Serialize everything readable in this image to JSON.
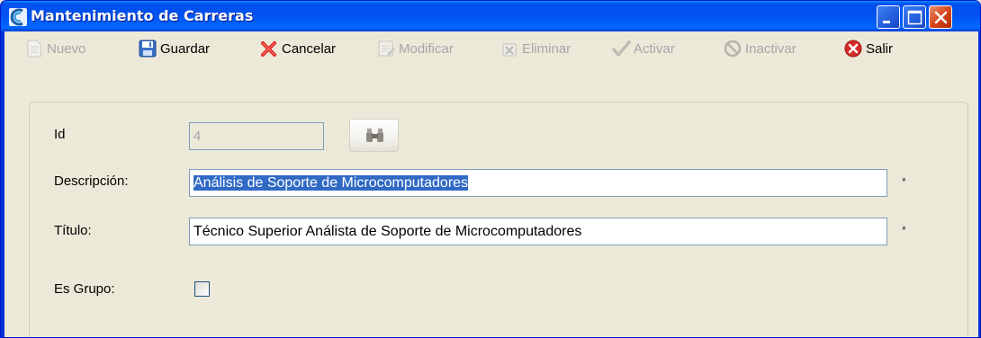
{
  "window": {
    "title": "Mantenimiento de Carreras"
  },
  "toolbar": {
    "nuevo": "Nuevo",
    "guardar": "Guardar",
    "cancelar": "Cancelar",
    "modificar": "Modificar",
    "eliminar": "Eliminar",
    "activar": "Activar",
    "inactivar": "Inactivar",
    "salir": "Salir"
  },
  "form": {
    "id_label": "Id",
    "id_value": "4",
    "descripcion_label": "Descripción:",
    "descripcion_value": "Análisis de Soporte de Microcomputadores",
    "titulo_label": "Título:",
    "titulo_value": "Técnico Superior Análista de Soporte de Microcomputadores",
    "es_grupo_label": "Es Grupo:",
    "es_grupo_checked": false,
    "required_marker": "*"
  },
  "icons": {
    "app": "app-logo-icon",
    "nuevo": "new-document-icon",
    "guardar": "floppy-disk-icon",
    "cancelar": "red-x-icon",
    "modificar": "edit-document-icon",
    "eliminar": "delete-icon",
    "activar": "checkmark-icon",
    "inactivar": "no-entry-icon",
    "salir": "exit-icon",
    "find": "binoculars-icon"
  },
  "colors": {
    "titlebar": "#0054E3",
    "face": "#ECE9D8",
    "selection": "#316AC5",
    "close": "#D9471C"
  }
}
